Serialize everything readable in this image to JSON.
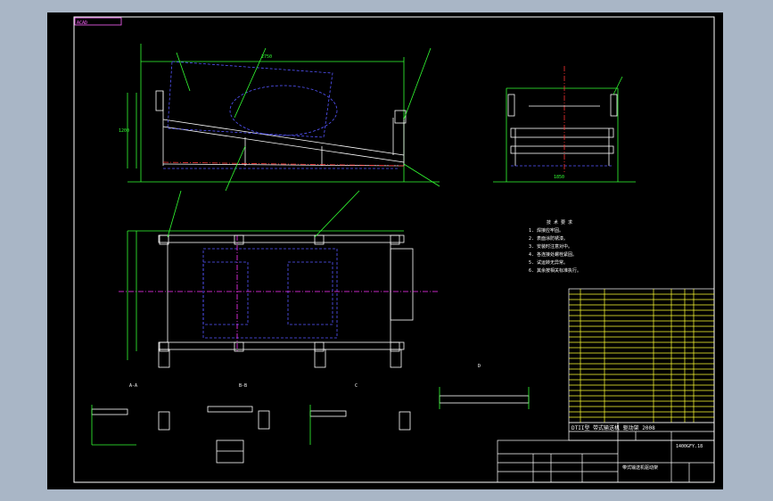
{
  "window": {
    "background_color": "#a9b6c6",
    "canvas_color": "#000000",
    "frame_color": "#ffffff"
  },
  "drawing": {
    "view_labels": [
      {
        "key": "sec_a",
        "text": "A-A"
      },
      {
        "key": "sec_b",
        "text": "B-B"
      },
      {
        "key": "sec_c",
        "text": "C"
      },
      {
        "key": "sec_d",
        "text": "D"
      }
    ],
    "dims": {
      "width_top": "2750",
      "height_left": "1200",
      "side_width": "1850"
    },
    "notes": {
      "title": "技 术 要 求",
      "lines": [
        "1. 焊接应牢固。",
        "2. 表面涂防锈漆。",
        "3. 安装时注意对中。",
        "4. 各连接处螺栓紧固。",
        "5. 试运转无异常。",
        "6. 其余按相关标准执行。"
      ]
    },
    "title_block": {
      "product_name": "DTII型 带式输送机 驱动架 2008",
      "drawing_no": "1400GFY.18",
      "sub_title": "带式输送机驱动架"
    }
  }
}
